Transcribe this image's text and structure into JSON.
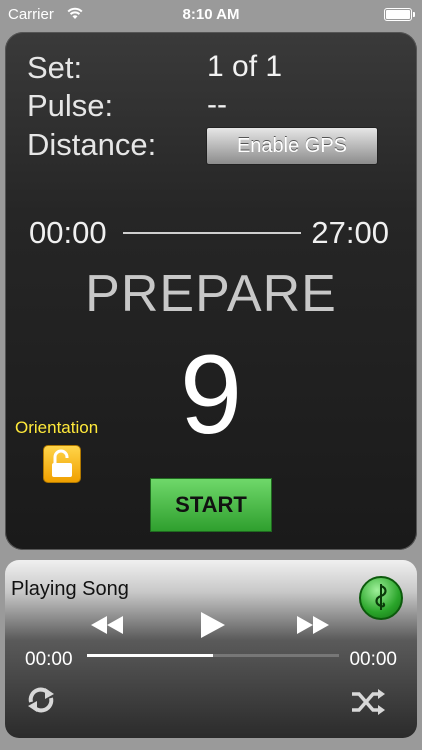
{
  "status_bar": {
    "carrier": "Carrier",
    "time": "8:10 AM"
  },
  "workout": {
    "set_label": "Set:",
    "set_value": "1 of 1",
    "pulse_label": "Pulse:",
    "pulse_value": "--",
    "distance_label": "Distance:",
    "enable_gps_label": "Enable GPS",
    "elapsed_time": "00:00",
    "total_time": "27:00",
    "phase": "PREPARE",
    "countdown": "9",
    "orientation_label": "Orientation",
    "start_label": "START"
  },
  "player": {
    "title": "Playing Song",
    "elapsed": "00:00",
    "remaining": "00:00",
    "progress": 0.5
  },
  "colors": {
    "accent_yellow": "#ffe93a",
    "start_green": "#3cb83a",
    "panel_dark": "#1f1f1f"
  },
  "icons": [
    "wifi-icon",
    "battery-icon",
    "lock-open-icon",
    "music-note-icon",
    "rewind-icon",
    "play-icon",
    "fast-forward-icon",
    "repeat-icon",
    "shuffle-icon"
  ]
}
